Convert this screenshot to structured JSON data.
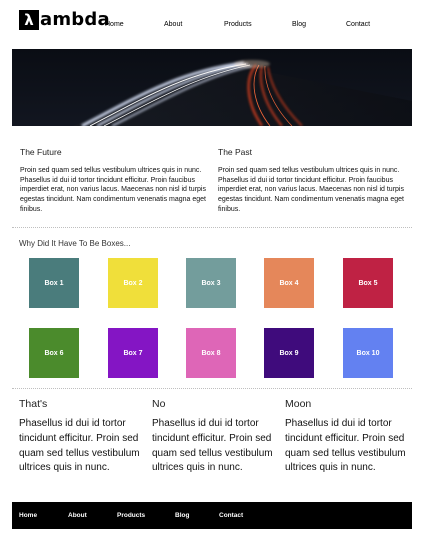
{
  "brand": {
    "mark": "λ",
    "name": "ambda"
  },
  "nav": [
    "Home",
    "About",
    "Products",
    "Blog",
    "Contact"
  ],
  "columns": [
    {
      "title": "The Future",
      "text": "Proin sed quam sed tellus vestibulum ultrices quis in nunc. Phasellus id dui id tortor tincidunt efficitur. Proin faucibus imperdiet erat, non varius lacus. Maecenas non nisl id turpis egestas tincidunt. Nam condimentum venenatis magna eget finibus."
    },
    {
      "title": "The Past",
      "text": "Proin sed quam sed tellus vestibulum ultrices quis in nunc. Phasellus id dui id tortor tincidunt efficitur. Proin faucibus imperdiet erat, non varius lacus. Maecenas non nisl id turpis egestas tincidunt. Nam condimentum venenatis magna eget finibus."
    }
  ],
  "boxes_title": "Why Did It Have To Be Boxes...",
  "boxes": [
    {
      "label": "Box 1",
      "color": "#4a7c7c"
    },
    {
      "label": "Box 2",
      "color": "#f0df3a"
    },
    {
      "label": "Box 3",
      "color": "#739d9c"
    },
    {
      "label": "Box 4",
      "color": "#e5875a"
    },
    {
      "label": "Box 5",
      "color": "#bf2244"
    },
    {
      "label": "Box 6",
      "color": "#4b8b2c"
    },
    {
      "label": "Box 7",
      "color": "#8415c4"
    },
    {
      "label": "Box 8",
      "color": "#de66b7"
    },
    {
      "label": "Box 9",
      "color": "#3f0b7c"
    },
    {
      "label": "Box 10",
      "color": "#6381f1"
    }
  ],
  "bottom": [
    {
      "title": "That's",
      "text": "Phasellus id dui id tortor tincidunt efficitur. Proin sed quam sed tellus vestibulum ultrices quis in nunc."
    },
    {
      "title": "No",
      "text": "Phasellus id dui id tortor tincidunt efficitur. Proin sed quam sed tellus vestibulum ultrices quis in nunc."
    },
    {
      "title": "Moon",
      "text": "Phasellus id dui id tortor tincidunt efficitur. Proin sed quam sed tellus vestibulum ultrices quis in nunc."
    }
  ],
  "footer_nav": [
    "Home",
    "About",
    "Products",
    "Blog",
    "Contact"
  ]
}
